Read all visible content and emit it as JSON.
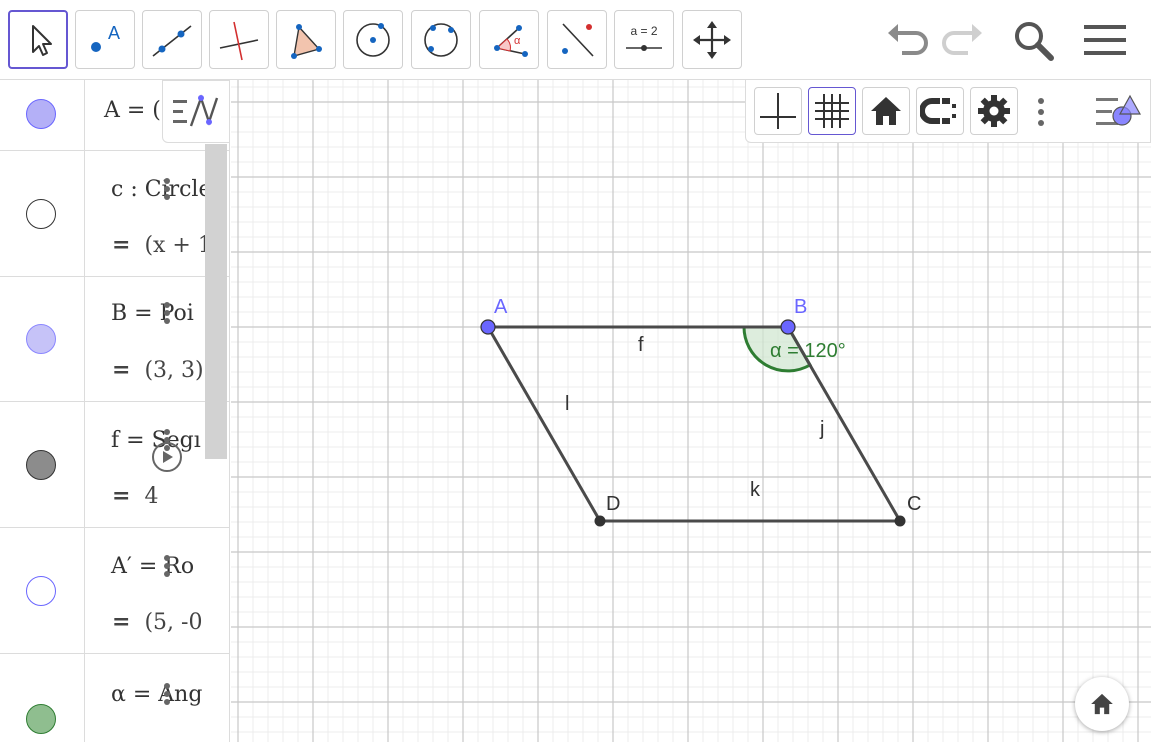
{
  "toolbar": {
    "tools": [
      {
        "name": "move-tool",
        "icon": "cursor-arrow-icon"
      },
      {
        "name": "point-tool",
        "icon": "point-icon",
        "label": "A"
      },
      {
        "name": "line-tool",
        "icon": "line-through-points-icon"
      },
      {
        "name": "perpendicular-line-tool",
        "icon": "perpendicular-line-icon"
      },
      {
        "name": "polygon-tool",
        "icon": "polygon-icon"
      },
      {
        "name": "circle-center-point-tool",
        "icon": "circle-center-icon"
      },
      {
        "name": "circle-three-points-tool",
        "icon": "circle-three-points-icon"
      },
      {
        "name": "angle-tool",
        "icon": "angle-icon",
        "label": "α"
      },
      {
        "name": "reflect-tool",
        "icon": "reflect-about-line-icon"
      },
      {
        "name": "slider-tool",
        "icon": "slider-icon",
        "label": "a = 2"
      },
      {
        "name": "move-graphics-view-tool",
        "icon": "move-arrows-icon"
      }
    ],
    "right_icons": [
      "undo-icon",
      "redo-icon",
      "search-icon",
      "menu-icon"
    ]
  },
  "algebra": {
    "rows": [
      {
        "color": "#b4b0f7",
        "line1": "A = (",
        "line2": ""
      },
      {
        "color": "#ffffff",
        "line1": "c : Circle",
        "line2": "(x + 1"
      },
      {
        "color": "#c6c3f8",
        "line1": "B = Poi",
        "line2": "(3, 3)"
      },
      {
        "color": "#8c8c8c",
        "line1": "f = Segı",
        "line2": "4"
      },
      {
        "color": "#ffffff",
        "line1": "A′ = Ro",
        "line2": "(5, -0"
      },
      {
        "color": "#8fbe8f",
        "line1": "α = Ang",
        "line2": ""
      }
    ],
    "equals": "="
  },
  "graphics_stylebar": {
    "buttons": [
      "axes-icon",
      "grid-icon",
      "home-icon",
      "point-capturing-icon",
      "settings-icon",
      "more-icon"
    ],
    "toggle_icon": "graphics-style-toggle-icon"
  },
  "graphics": {
    "points": [
      {
        "label": "A",
        "color": "#6a66ff"
      },
      {
        "label": "B",
        "color": "#6a66ff"
      },
      {
        "label": "C",
        "color": "#333333"
      },
      {
        "label": "D",
        "color": "#333333"
      }
    ],
    "segments": [
      "f",
      "j",
      "k",
      "l"
    ],
    "angle_label": "α = 120°",
    "angle_color": "#2e7d32"
  }
}
